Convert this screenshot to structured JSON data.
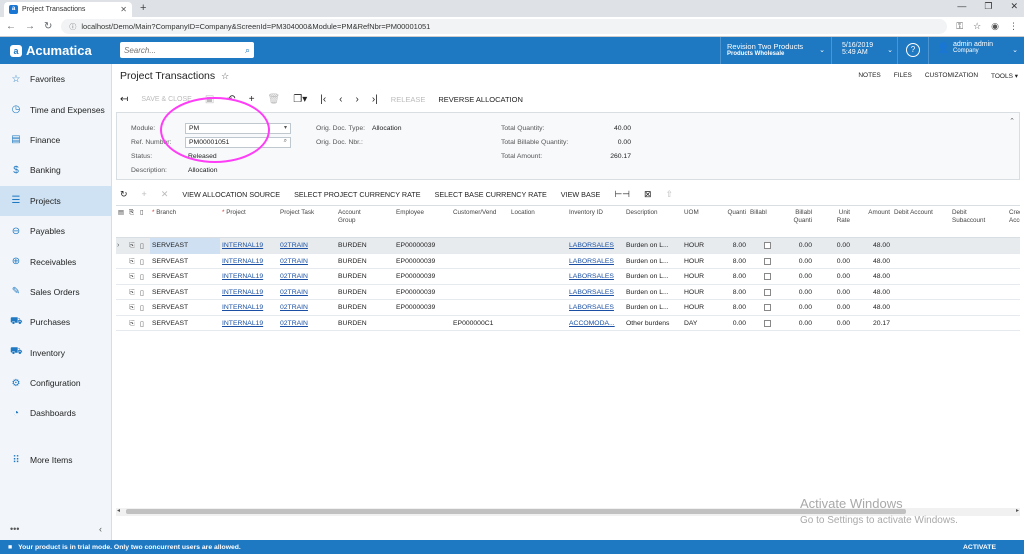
{
  "browser": {
    "tab_title": "Project Transactions",
    "tab_favicon": "a",
    "new_tab": "+",
    "url": "localhost/Demo/Main?CompanyID=Company&ScreenId=PM304000&Module=PM&RefNbr=PM00001051"
  },
  "topbar": {
    "logo": "Acumatica",
    "search_placeholder": "Search...",
    "tenant_name": "Revision Two Products",
    "tenant_branch": "Products Wholesale",
    "date": "5/16/2019",
    "time": "5:49 AM",
    "help": "?",
    "user_name": "admin admin",
    "user_company": "Company",
    "accent": "#1e78c2"
  },
  "sidebar": {
    "items": [
      {
        "label": "Favorites",
        "icon": "star-icon",
        "glyph": "☆"
      },
      {
        "label": "Time and Expenses",
        "icon": "clock-icon",
        "glyph": "◷"
      },
      {
        "label": "Finance",
        "icon": "document-icon",
        "glyph": "▤"
      },
      {
        "label": "Banking",
        "icon": "dollar-icon",
        "glyph": "$"
      },
      {
        "label": "Projects",
        "icon": "projects-icon",
        "glyph": "☰"
      },
      {
        "label": "Payables",
        "icon": "minus-circle-icon",
        "glyph": "⊖"
      },
      {
        "label": "Receivables",
        "icon": "plus-circle-icon",
        "glyph": "⊕"
      },
      {
        "label": "Sales Orders",
        "icon": "edit-icon",
        "glyph": "✎"
      },
      {
        "label": "Purchases",
        "icon": "cart-icon",
        "glyph": "⛟"
      },
      {
        "label": "Inventory",
        "icon": "truck-icon",
        "glyph": "⛟"
      },
      {
        "label": "Configuration",
        "icon": "gear-icon",
        "glyph": "⚙"
      },
      {
        "label": "Dashboards",
        "icon": "gauge-icon",
        "glyph": "◔"
      }
    ],
    "more_label": "More Items",
    "footer_dots": "•••",
    "footer_collapse": "‹"
  },
  "page": {
    "title": "Project Transactions",
    "links": [
      "NOTES",
      "FILES",
      "CUSTOMIZATION",
      "TOOLS ▾"
    ],
    "toolbar": {
      "save_close": "SAVE & CLOSE",
      "release": "RELEASE",
      "reverse_allocation": "REVERSE ALLOCATION"
    }
  },
  "form": {
    "module_label": "Module:",
    "module_value": "PM",
    "refnbr_label": "Ref. Number:",
    "refnbr_value": "PM00001051",
    "status_label": "Status:",
    "status_value": "Released",
    "description_label": "Description:",
    "description_value": "Allocation",
    "origdoctype_label": "Orig. Doc. Type:",
    "origdoctype_value": "Allocation",
    "origdocnbr_label": "Orig. Doc. Nbr.:",
    "total_qty_label": "Total Quantity:",
    "total_qty_value": "40.00",
    "total_billable_label": "Total Billable Quantity:",
    "total_billable_value": "0.00",
    "total_amount_label": "Total Amount:",
    "total_amount_value": "260.17"
  },
  "grid_toolbar": {
    "view_allocation_source": "VIEW ALLOCATION SOURCE",
    "select_project_currency_rate": "SELECT PROJECT CURRENCY RATE",
    "select_base_currency_rate": "SELECT BASE CURRENCY RATE",
    "view_base": "VIEW BASE"
  },
  "grid": {
    "headers": {
      "branch": "Branch",
      "project": "Project",
      "project_task": "Project Task",
      "account_group": "Account Group",
      "employee": "Employee",
      "customer_vendor": "Customer/Vend",
      "location": "Location",
      "inventory_id": "Inventory ID",
      "description": "Description",
      "uom": "UOM",
      "quantity": "Quanti",
      "billable": "Billabl",
      "billable_qty": "Billabl Quanti",
      "unit_rate": "Unit Rate",
      "amount": "Amount",
      "debit_account": "Debit Account",
      "debit_subaccount": "Debit Subaccount",
      "credit_account": "Cred Acco"
    },
    "rows": [
      {
        "branch": "SERVEAST",
        "project": "INTERNAL19",
        "task": "02TRAIN",
        "account_group": "BURDEN",
        "employee": "EP00000039",
        "customer": "",
        "inventory": "LABORSALES",
        "description": "Burden on L...",
        "uom": "HOUR",
        "qty": "8.00",
        "billable_qty": "0.00",
        "unit_rate": "0.00",
        "amount": "48.00"
      },
      {
        "branch": "SERVEAST",
        "project": "INTERNAL19",
        "task": "02TRAIN",
        "account_group": "BURDEN",
        "employee": "EP00000039",
        "customer": "",
        "inventory": "LABORSALES",
        "description": "Burden on L...",
        "uom": "HOUR",
        "qty": "8.00",
        "billable_qty": "0.00",
        "unit_rate": "0.00",
        "amount": "48.00"
      },
      {
        "branch": "SERVEAST",
        "project": "INTERNAL19",
        "task": "02TRAIN",
        "account_group": "BURDEN",
        "employee": "EP00000039",
        "customer": "",
        "inventory": "LABORSALES",
        "description": "Burden on L...",
        "uom": "HOUR",
        "qty": "8.00",
        "billable_qty": "0.00",
        "unit_rate": "0.00",
        "amount": "48.00"
      },
      {
        "branch": "SERVEAST",
        "project": "INTERNAL19",
        "task": "02TRAIN",
        "account_group": "BURDEN",
        "employee": "EP00000039",
        "customer": "",
        "inventory": "LABORSALES",
        "description": "Burden on L...",
        "uom": "HOUR",
        "qty": "8.00",
        "billable_qty": "0.00",
        "unit_rate": "0.00",
        "amount": "48.00"
      },
      {
        "branch": "SERVEAST",
        "project": "INTERNAL19",
        "task": "02TRAIN",
        "account_group": "BURDEN",
        "employee": "EP00000039",
        "customer": "",
        "inventory": "LABORSALES",
        "description": "Burden on L...",
        "uom": "HOUR",
        "qty": "8.00",
        "billable_qty": "0.00",
        "unit_rate": "0.00",
        "amount": "48.00"
      },
      {
        "branch": "SERVEAST",
        "project": "INTERNAL19",
        "task": "02TRAIN",
        "account_group": "BURDEN",
        "employee": "",
        "customer": "EP000000C1",
        "inventory": "ACCOMODA...",
        "description": "Other burdens",
        "uom": "DAY",
        "qty": "0.00",
        "billable_qty": "0.00",
        "unit_rate": "0.00",
        "amount": "20.17"
      }
    ]
  },
  "watermark": {
    "line1": "Activate Windows",
    "line2": "Go to Settings to activate Windows."
  },
  "status_bar": {
    "message": "Your product is in trial mode. Only two concurrent users are allowed.",
    "activate": "ACTIVATE"
  }
}
